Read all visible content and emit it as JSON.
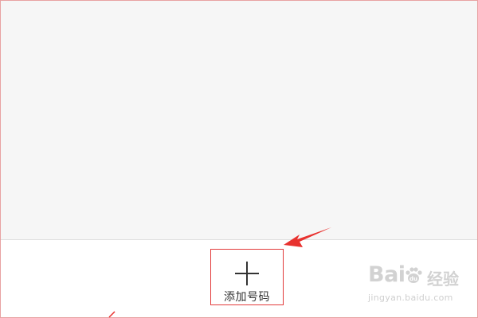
{
  "add_button": {
    "label": "添加号码",
    "icon": "plus-icon"
  },
  "annotation": {
    "arrow_color": "#e8322f"
  },
  "watermark": {
    "brand": "Bai",
    "brand_suffix": "经验",
    "url": "jingyan.baidu.com"
  },
  "colors": {
    "content_background": "#f6f6f6",
    "button_highlight_border": "#e23a3a",
    "icon_color": "#333333"
  }
}
